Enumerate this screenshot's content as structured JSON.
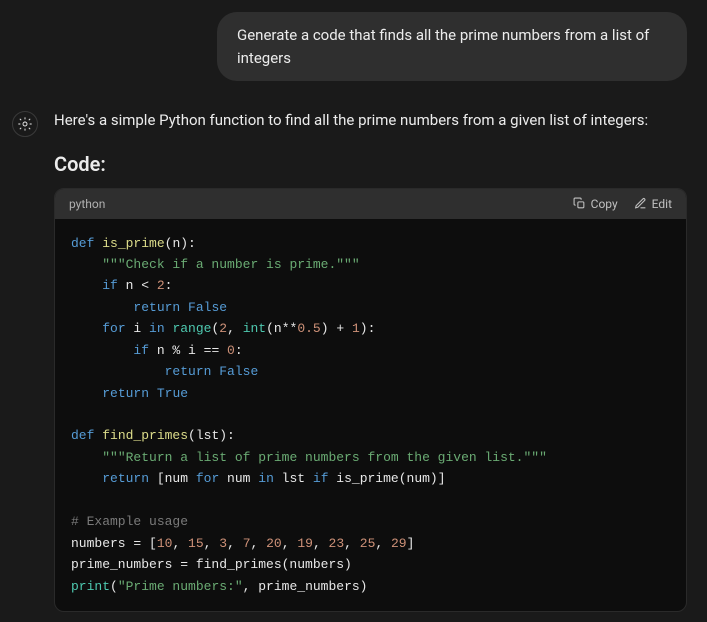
{
  "user": {
    "text": "Generate a code that finds all the prime numbers from a list of integers"
  },
  "assistant": {
    "intro": "Here's a simple Python function to find all the prime numbers from a given list of integers:",
    "heading": "Code:"
  },
  "codeblock": {
    "lang": "python",
    "actions": {
      "copy": "Copy",
      "edit": "Edit"
    },
    "tokens": [
      [
        [
          "kw",
          "def "
        ],
        [
          "fn",
          "is_prime"
        ],
        [
          "",
          "(n):"
        ]
      ],
      [
        [
          "",
          "    "
        ],
        [
          "str",
          "\"\"\"Check if a number is prime.\"\"\""
        ]
      ],
      [
        [
          "",
          "    "
        ],
        [
          "kw",
          "if"
        ],
        [
          "",
          " n < "
        ],
        [
          "num",
          "2"
        ],
        [
          "",
          ":"
        ]
      ],
      [
        [
          "",
          "        "
        ],
        [
          "kw",
          "return"
        ],
        [
          "",
          " "
        ],
        [
          "kw",
          "False"
        ]
      ],
      [
        [
          "",
          "    "
        ],
        [
          "kw",
          "for"
        ],
        [
          "",
          " i "
        ],
        [
          "kw",
          "in"
        ],
        [
          "",
          " "
        ],
        [
          "bi",
          "range"
        ],
        [
          "",
          "("
        ],
        [
          "num",
          "2"
        ],
        [
          "",
          ", "
        ],
        [
          "bi",
          "int"
        ],
        [
          "",
          "(n**"
        ],
        [
          "num",
          "0.5"
        ],
        [
          "",
          ") + "
        ],
        [
          "num",
          "1"
        ],
        [
          "",
          "):"
        ]
      ],
      [
        [
          "",
          "        "
        ],
        [
          "kw",
          "if"
        ],
        [
          "",
          " n % i == "
        ],
        [
          "num",
          "0"
        ],
        [
          "",
          ":"
        ]
      ],
      [
        [
          "",
          "            "
        ],
        [
          "kw",
          "return"
        ],
        [
          "",
          " "
        ],
        [
          "kw",
          "False"
        ]
      ],
      [
        [
          "",
          "    "
        ],
        [
          "kw",
          "return"
        ],
        [
          "",
          " "
        ],
        [
          "kw",
          "True"
        ]
      ],
      [
        [
          "",
          ""
        ]
      ],
      [
        [
          "kw",
          "def "
        ],
        [
          "fn",
          "find_primes"
        ],
        [
          "",
          "(lst):"
        ]
      ],
      [
        [
          "",
          "    "
        ],
        [
          "str",
          "\"\"\"Return a list of prime numbers from the given list.\"\"\""
        ]
      ],
      [
        [
          "",
          "    "
        ],
        [
          "kw",
          "return"
        ],
        [
          "",
          " [num "
        ],
        [
          "kw",
          "for"
        ],
        [
          "",
          " num "
        ],
        [
          "kw",
          "in"
        ],
        [
          "",
          " lst "
        ],
        [
          "kw",
          "if"
        ],
        [
          "",
          " is_prime(num)]"
        ]
      ],
      [
        [
          "",
          ""
        ]
      ],
      [
        [
          "cm",
          "# Example usage"
        ]
      ],
      [
        [
          "",
          "numbers = ["
        ],
        [
          "num",
          "10"
        ],
        [
          "",
          ", "
        ],
        [
          "num",
          "15"
        ],
        [
          "",
          ", "
        ],
        [
          "num",
          "3"
        ],
        [
          "",
          ", "
        ],
        [
          "num",
          "7"
        ],
        [
          "",
          ", "
        ],
        [
          "num",
          "20"
        ],
        [
          "",
          ", "
        ],
        [
          "num",
          "19"
        ],
        [
          "",
          ", "
        ],
        [
          "num",
          "23"
        ],
        [
          "",
          ", "
        ],
        [
          "num",
          "25"
        ],
        [
          "",
          ", "
        ],
        [
          "num",
          "29"
        ],
        [
          "",
          "]"
        ]
      ],
      [
        [
          "",
          "prime_numbers = find_primes(numbers)"
        ]
      ],
      [
        [
          "bi",
          "print"
        ],
        [
          "",
          "("
        ],
        [
          "str",
          "\"Prime numbers:\""
        ],
        [
          "",
          ", prime_numbers)"
        ]
      ]
    ]
  }
}
